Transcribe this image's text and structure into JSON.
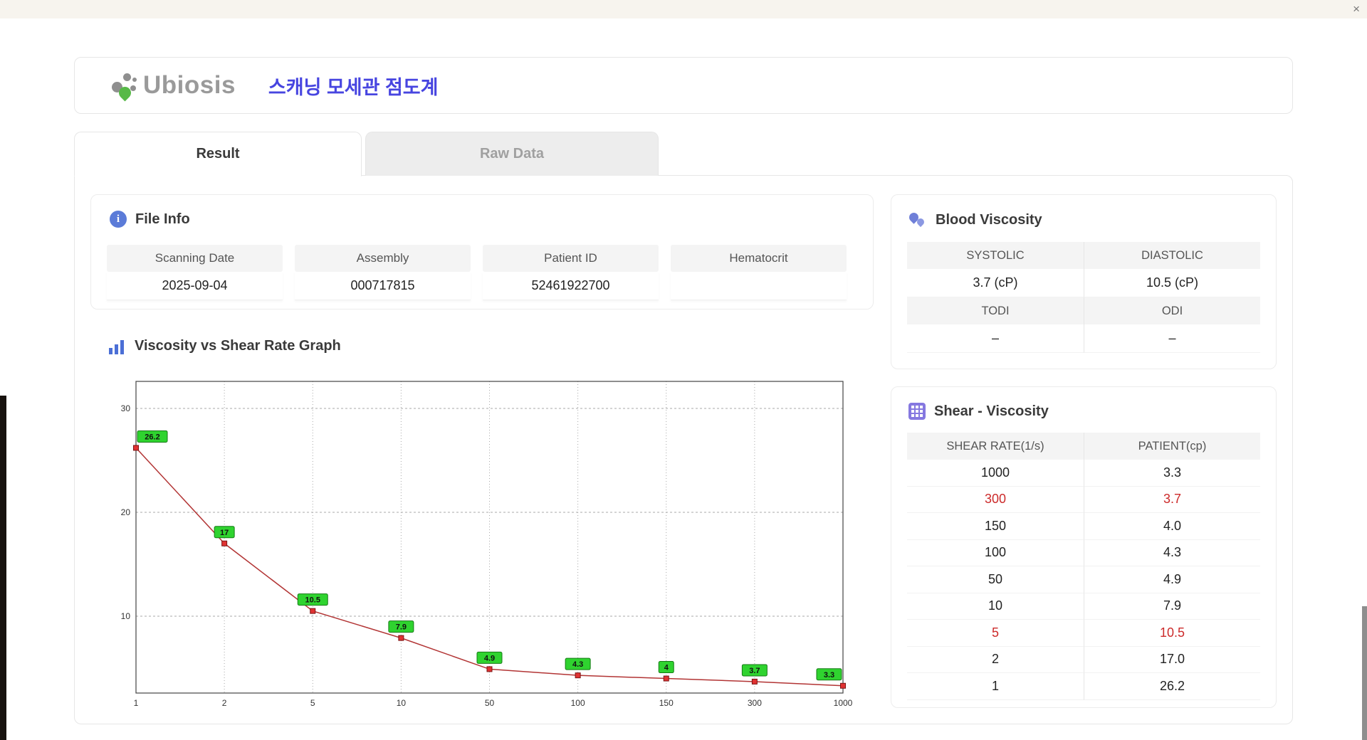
{
  "window": {
    "close_label": "×"
  },
  "header": {
    "logo_text": "Ubiosis",
    "title": "스캐닝 모세관 점도계"
  },
  "tabs": [
    {
      "label": "Result",
      "active": true
    },
    {
      "label": "Raw Data",
      "active": false
    }
  ],
  "file_info": {
    "title": "File Info",
    "fields": [
      {
        "label": "Scanning Date",
        "value": "2025-09-04"
      },
      {
        "label": "Assembly",
        "value": "000717815"
      },
      {
        "label": "Patient ID",
        "value": "52461922700"
      },
      {
        "label": "Hematocrit",
        "value": ""
      }
    ]
  },
  "blood_viscosity": {
    "title": "Blood Viscosity",
    "cells": [
      {
        "label": "SYSTOLIC",
        "value": "3.7 (cP)"
      },
      {
        "label": "DIASTOLIC",
        "value": "10.5 (cP)"
      },
      {
        "label": "TODI",
        "value": "–"
      },
      {
        "label": "ODI",
        "value": "–"
      }
    ]
  },
  "graph": {
    "title": "Viscosity vs Shear Rate Graph"
  },
  "chart_data": {
    "type": "line",
    "title": "Viscosity vs Shear Rate Graph",
    "x_categories": [
      "1",
      "2",
      "5",
      "10",
      "50",
      "100",
      "150",
      "300",
      "1000"
    ],
    "values": [
      26.2,
      17,
      10.5,
      7.9,
      4.9,
      4.3,
      4,
      3.7,
      3.3
    ],
    "point_labels": [
      "26.2",
      "17",
      "10.5",
      "7.9",
      "4.9",
      "4.3",
      "4",
      "3.7",
      "3.3"
    ],
    "xlabel": "",
    "ylabel": "",
    "yticks": [
      10,
      20,
      30
    ],
    "ylim": [
      2.6,
      32.6
    ],
    "x_scale": "categorical-log-spaced",
    "grid": true,
    "legend": false,
    "line_color": "#b23434",
    "marker_color": "#e03232",
    "marker_stroke": "#7a1515",
    "label_bg": "#2fd32f",
    "label_stroke": "#157a15",
    "grid_color": "#a8a8a8",
    "axis_color": "#444444"
  },
  "shear_table": {
    "title": "Shear - Viscosity",
    "columns": [
      "SHEAR RATE(1/s)",
      "PATIENT(cp)"
    ],
    "rows": [
      {
        "rate": "1000",
        "patient": "3.3",
        "highlight": false
      },
      {
        "rate": "300",
        "patient": "3.7",
        "highlight": true
      },
      {
        "rate": "150",
        "patient": "4.0",
        "highlight": false
      },
      {
        "rate": "100",
        "patient": "4.3",
        "highlight": false
      },
      {
        "rate": "50",
        "patient": "4.9",
        "highlight": false
      },
      {
        "rate": "10",
        "patient": "7.9",
        "highlight": false
      },
      {
        "rate": "5",
        "patient": "10.5",
        "highlight": true
      },
      {
        "rate": "2",
        "patient": "17.0",
        "highlight": false
      },
      {
        "rate": "1",
        "patient": "26.2",
        "highlight": false
      }
    ]
  },
  "colors": {
    "accent_title": "#4745e0",
    "highlight_red": "#cc2a2a",
    "logo_green": "#57b947",
    "icon_blue": "#5b7bd8",
    "icon_purple": "#8578e0"
  }
}
